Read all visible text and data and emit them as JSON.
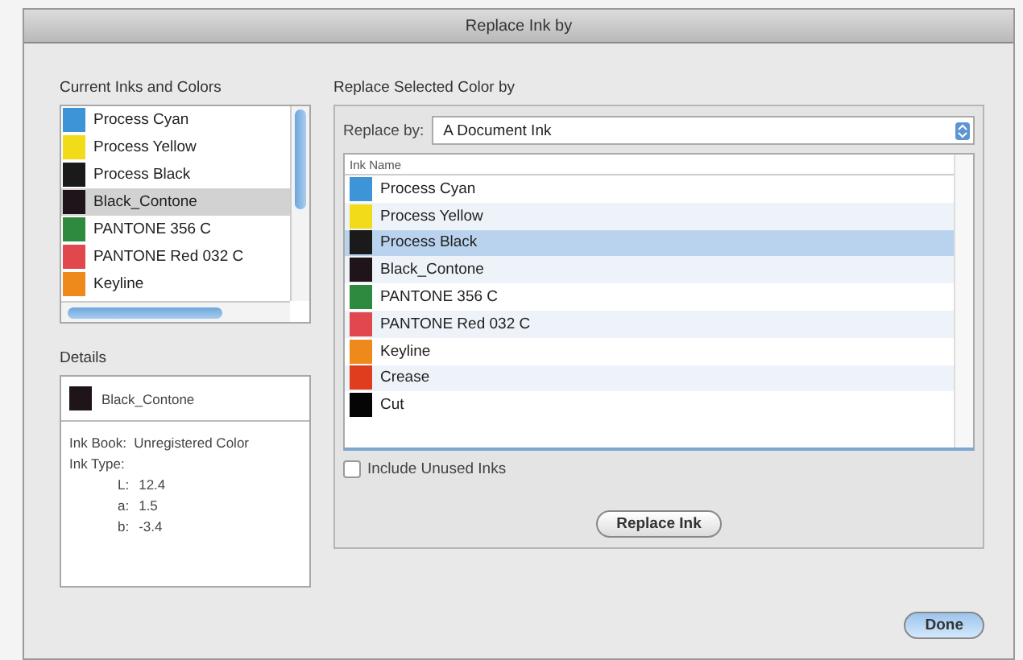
{
  "window": {
    "title": "Replace Ink by"
  },
  "current_inks": {
    "title": "Current Inks and Colors",
    "items": [
      {
        "name": "Process Cyan",
        "color": "#3d94d6",
        "selected": false
      },
      {
        "name": "Process Yellow",
        "color": "#f2dc1a",
        "selected": false
      },
      {
        "name": "Process Black",
        "color": "#1a1a1a",
        "selected": false
      },
      {
        "name": "Black_Contone",
        "color": "#1e1419",
        "selected": true
      },
      {
        "name": "PANTONE 356 C",
        "color": "#2e8a3e",
        "selected": false
      },
      {
        "name": "PANTONE Red 032 C",
        "color": "#e0484e",
        "selected": false
      },
      {
        "name": "Keyline",
        "color": "#ee8a1c",
        "selected": false
      }
    ]
  },
  "details": {
    "title": "Details",
    "name": "Black_Contone",
    "lines": [
      {
        "label": "Ink Book:",
        "value": "Unregistered Color"
      },
      {
        "label": "Ink Type:"
      }
    ],
    "values": [
      {
        "label": "L:",
        "value": "12.4"
      },
      {
        "label": "a:",
        "value": "1.5"
      },
      {
        "label": "b:",
        "value": "-3.4"
      }
    ]
  },
  "replace": {
    "title": "Replace Selected Color by",
    "replace_by_label": "Replace by:",
    "replace_by_value": "A Document Ink",
    "column": "Ink Name",
    "items": [
      {
        "name": "Process Cyan",
        "color": "#3d94d6",
        "selected": false
      },
      {
        "name": "Process Yellow",
        "color": "#f2dc1a",
        "selected": false
      },
      {
        "name": "Process Black",
        "color": "#1a1a1a",
        "selected": true
      },
      {
        "name": "Black_Contone",
        "color": "#1e1419",
        "selected": false
      },
      {
        "name": "PANTONE 356 C",
        "color": "#2e8a3e",
        "selected": false
      },
      {
        "name": "PANTONE Red 032 C",
        "color": "#e0484e",
        "selected": false
      },
      {
        "name": "Keyline",
        "color": "#ee8a1c",
        "selected": false
      },
      {
        "name": "Crease",
        "color": "#e03c1e",
        "selected": false
      },
      {
        "name": "Cut",
        "color": "#050505",
        "selected": false
      }
    ],
    "include_unused": {
      "label": "Include Unused Inks",
      "checked": false
    },
    "button": "Replace Ink"
  },
  "done_button": "Done"
}
